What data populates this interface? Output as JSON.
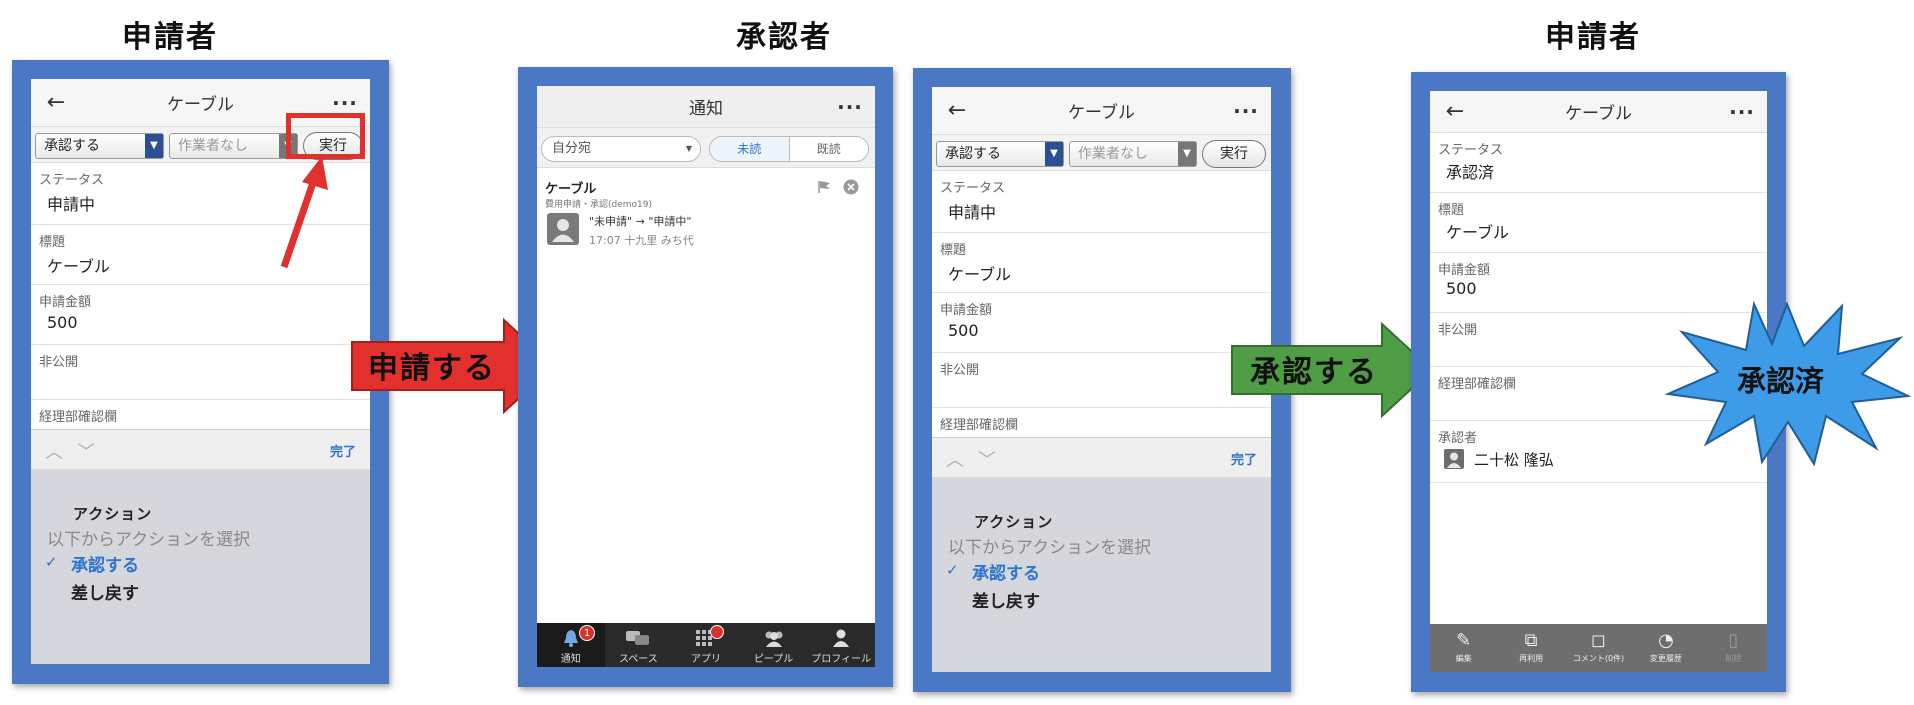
{
  "headings": {
    "applicant_left": "申請者",
    "approver": "承認者",
    "applicant_right": "申請者"
  },
  "common": {
    "back_glyph": "←",
    "more_glyph": "···",
    "caret_glyph": "▼",
    "title": "ケーブル",
    "action_approve": "承認する",
    "worker_none": "作業者なし",
    "run_label": "実行",
    "done_label": "完了",
    "up_glyph": "︿",
    "down_glyph": "﹀",
    "check_glyph": "✓"
  },
  "labels": {
    "status": "ステータス",
    "subject": "標題",
    "amount": "申請金額",
    "private": "非公開",
    "accounting": "経理部確認欄",
    "approver": "承認者"
  },
  "values": {
    "status_pending": "申請中",
    "status_approved": "承認済",
    "subject": "ケーブル",
    "amount": "500",
    "approver_name": "二十松 隆弘"
  },
  "picker": {
    "title": "アクション",
    "prompt": "以下からアクションを選択",
    "options": [
      "承認する",
      "差し戻す"
    ]
  },
  "notification": {
    "title": "通知",
    "filter": "自分宛",
    "seg_unread": "未読",
    "seg_read": "既読",
    "item_title": "ケーブル",
    "item_sub": "費用申請・承認(demo19)",
    "item_change": "\"未申請\" → \"申請中\"",
    "item_meta": "17:07  十九里 みち代",
    "tabs": [
      "通知",
      "スペース",
      "アプリ",
      "ピープル",
      "プロフィール"
    ],
    "badge": "1"
  },
  "arrows": {
    "apply": "申請する",
    "approve": "承認する"
  },
  "burst": {
    "label": "承認済"
  },
  "bottom_actions": [
    "編集",
    "再利用",
    "コメント(0件)",
    "変更履歴",
    "削除"
  ],
  "colors": {
    "frame": "#4a78c4",
    "red_arrow": "#e2302d",
    "green_arrow": "#4f9e46",
    "burst": "#3d9be8",
    "link_blue": "#2f74d0"
  }
}
